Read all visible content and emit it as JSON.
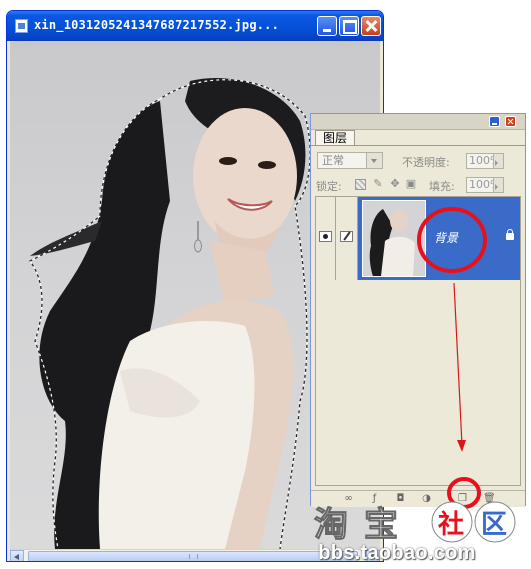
{
  "window": {
    "title": "xin_1031205241347687217552.jpg...",
    "buttons": [
      "minimize",
      "maximize",
      "close"
    ]
  },
  "layers_panel": {
    "tab_label": "图层",
    "blend_mode": "正常",
    "opacity_label": "不透明度:",
    "opacity_value": "100%",
    "lock_label": "锁定:",
    "fill_label": "填充:",
    "fill_value": "100%",
    "layers": [
      {
        "name": "背景",
        "visible": true,
        "selected": true,
        "locked": true
      }
    ],
    "bottom_icons": [
      "link-icon",
      "style-icon",
      "mask-icon",
      "adjustment-icon",
      "new-layer-icon",
      "trash-icon"
    ]
  },
  "annotations": {
    "circle_color": "#e8101c",
    "arrow_color": "#d81818"
  },
  "watermark": {
    "logo_text": "淘宝社区",
    "url": "bbs.taobao.com"
  },
  "colors": {
    "xp_title_blue": "#0552d9",
    "layer_selected": "#3a6bc9",
    "panel_bg": "#ece9d8"
  }
}
